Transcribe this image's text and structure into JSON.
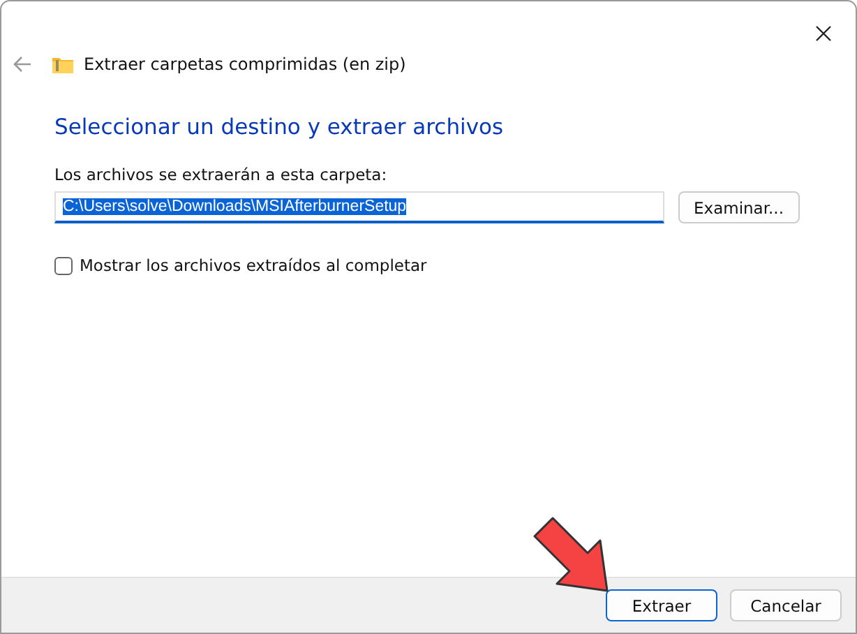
{
  "window": {
    "title": "Extraer carpetas comprimidas (en zip)"
  },
  "heading": "Seleccionar un destino y extraer archivos",
  "destination": {
    "label": "Los archivos se extraerán a esta carpeta:",
    "value": "C:\\Users\\solve\\Downloads\\MSIAfterburnerSetup",
    "value_selected": true,
    "browse_button": "Examinar..."
  },
  "show_files": {
    "label": "Mostrar los archivos extraídos al completar",
    "checked": false
  },
  "buttons": [
    {
      "label": "Extraer",
      "default": true
    },
    {
      "label": "Cancelar",
      "default": false
    }
  ]
}
